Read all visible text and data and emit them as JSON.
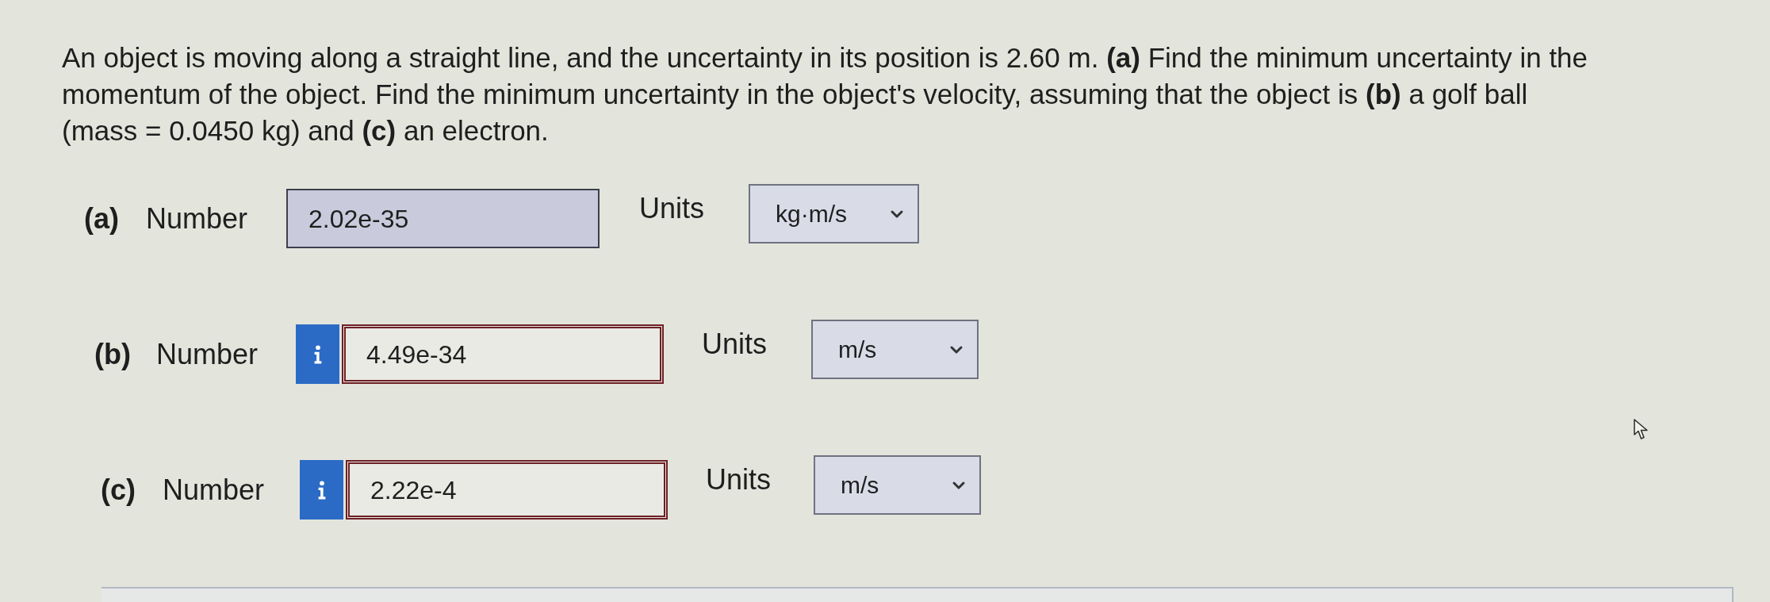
{
  "question": "An object is moving along a straight line, and the uncertainty in its position is 2.60 m. **(a)** Find the minimum uncertainty in the momentum of the object. Find the minimum uncertainty in the object's velocity, assuming that the object is **(b)** a golf ball (mass = 0.0450 kg) and **(c)** an electron.",
  "parts": [
    {
      "label": "(a)",
      "number_label": "Number",
      "value": "2.02e-35",
      "info_button": false,
      "incorrect": false,
      "units_label": "Units",
      "units": "kg·m/s"
    },
    {
      "label": "(b)",
      "number_label": "Number",
      "value": "4.49e-34",
      "info_button": true,
      "incorrect": true,
      "units_label": "Units",
      "units": "m/s"
    },
    {
      "label": "(c)",
      "number_label": "Number",
      "value": "2.22e-4",
      "info_button": true,
      "incorrect": true,
      "units_label": "Units",
      "units": "m/s"
    }
  ]
}
